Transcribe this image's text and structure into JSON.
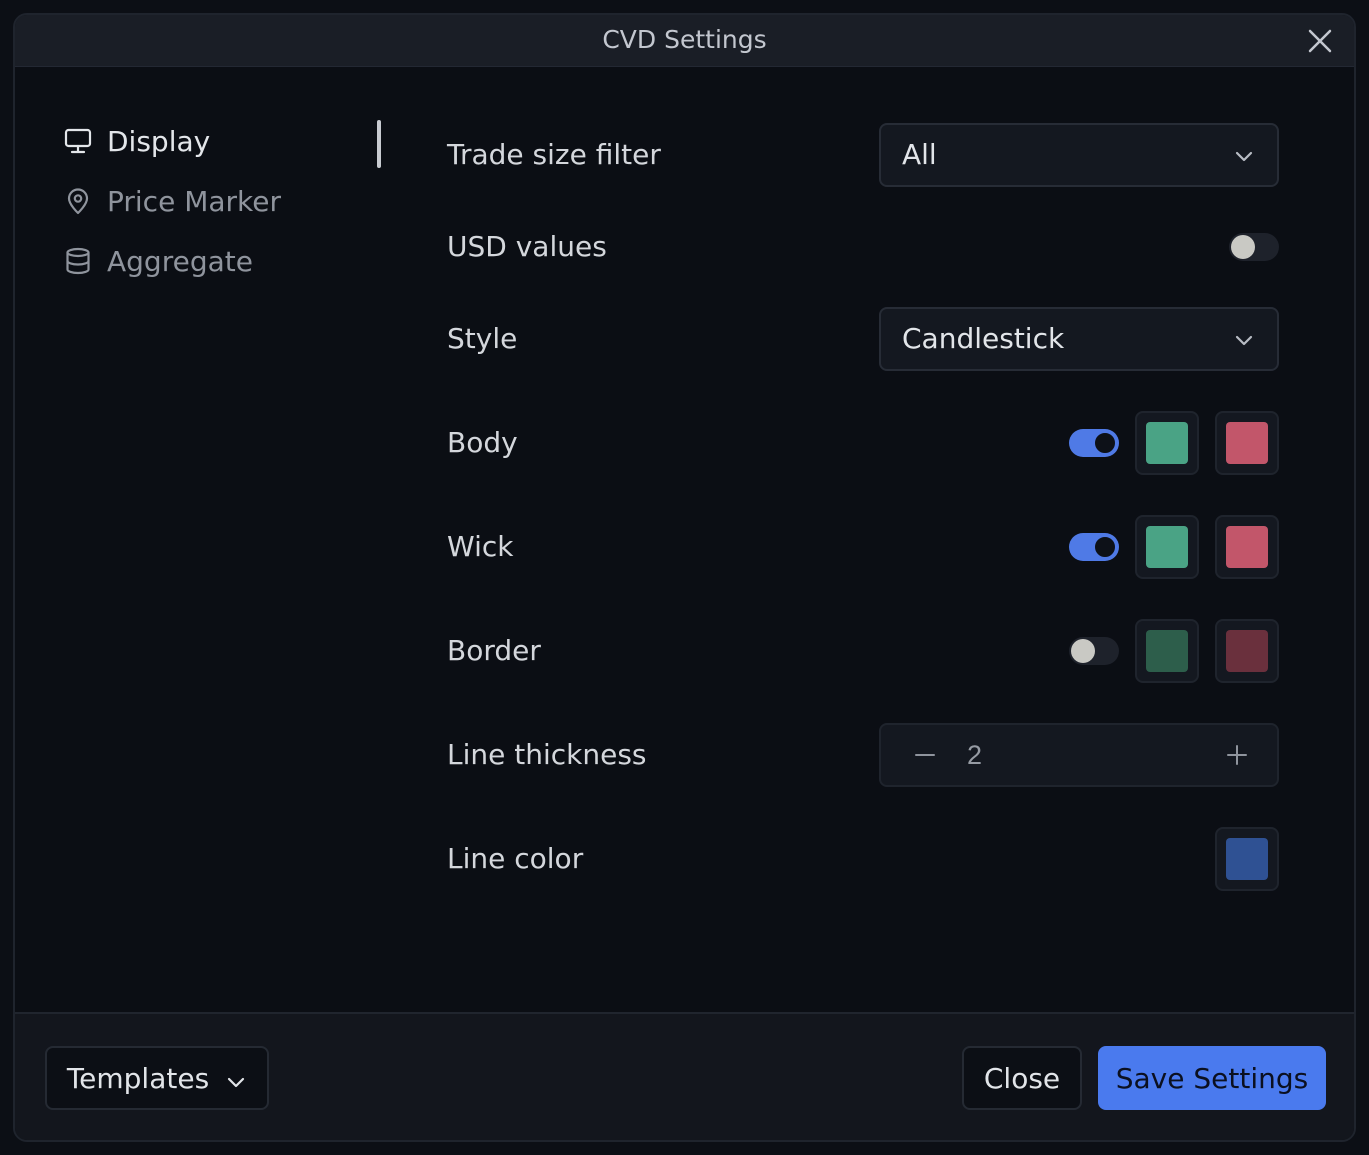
{
  "dialog": {
    "title": "CVD Settings"
  },
  "nav": {
    "items": [
      {
        "label": "Display",
        "icon": "monitor-icon",
        "active": true
      },
      {
        "label": "Price Marker",
        "icon": "map-pin-icon",
        "active": false
      },
      {
        "label": "Aggregate",
        "icon": "database-icon",
        "active": false
      }
    ]
  },
  "settings": {
    "trade_size_filter": {
      "label": "Trade size filter",
      "value": "All"
    },
    "usd_values": {
      "label": "USD values",
      "enabled": false
    },
    "style": {
      "label": "Style",
      "value": "Candlestick"
    },
    "body": {
      "label": "Body",
      "enabled": true,
      "up_color": "#4aa385",
      "down_color": "#c2566a"
    },
    "wick": {
      "label": "Wick",
      "enabled": true,
      "up_color": "#4aa385",
      "down_color": "#c2566a"
    },
    "border": {
      "label": "Border",
      "enabled": false,
      "up_color": "#2d5e4b",
      "down_color": "#6a303d"
    },
    "line_thickness": {
      "label": "Line thickness",
      "value": "2"
    },
    "line_color": {
      "label": "Line color",
      "color": "#2f5193"
    }
  },
  "footer": {
    "templates_label": "Templates",
    "close_label": "Close",
    "save_label": "Save Settings"
  }
}
